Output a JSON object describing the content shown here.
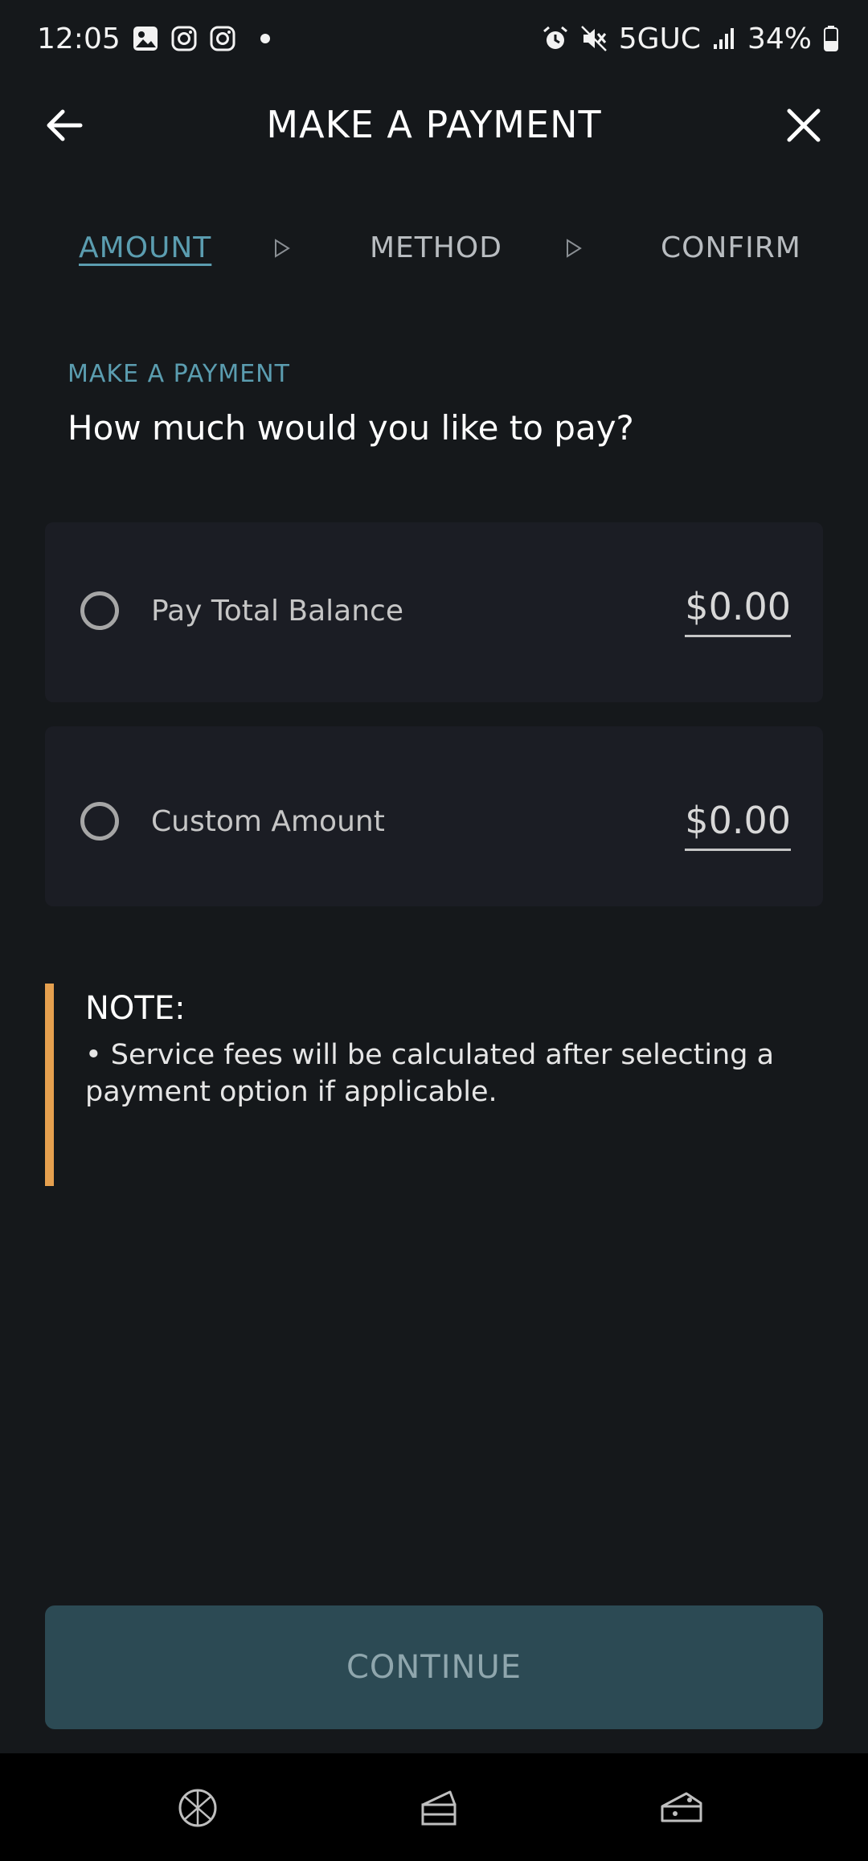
{
  "status_bar": {
    "time": "12:05",
    "network": "5GUC",
    "battery": "34%",
    "icons": [
      "gallery-icon",
      "instagram-icon",
      "instagram-icon",
      "alarm-icon",
      "mute-icon",
      "signal-icon",
      "battery-icon"
    ]
  },
  "header": {
    "title": "MAKE A PAYMENT",
    "back_icon": "arrow-left-icon",
    "close_icon": "close-icon"
  },
  "steps": [
    {
      "label": "AMOUNT",
      "active": true
    },
    {
      "label": "METHOD",
      "active": false
    },
    {
      "label": "CONFIRM",
      "active": false
    }
  ],
  "section": {
    "label": "MAKE A PAYMENT",
    "question": "How much would you like to pay?"
  },
  "options": [
    {
      "label": "Pay Total Balance",
      "amount": "$0.00",
      "selected": false
    },
    {
      "label": "Custom Amount",
      "amount": "$0.00",
      "selected": false
    }
  ],
  "note": {
    "title": "NOTE:",
    "text": "• Service fees will be calculated after selecting a payment option if applicable."
  },
  "continue_label": "CONTINUE",
  "colors": {
    "background": "#15181b",
    "accent": "#5b9db0",
    "note_bar": "#e5a04f",
    "button": "#2c4a54"
  },
  "bottom_nav": [
    "cookie-icon",
    "cake-slice-icon",
    "cheese-icon"
  ]
}
